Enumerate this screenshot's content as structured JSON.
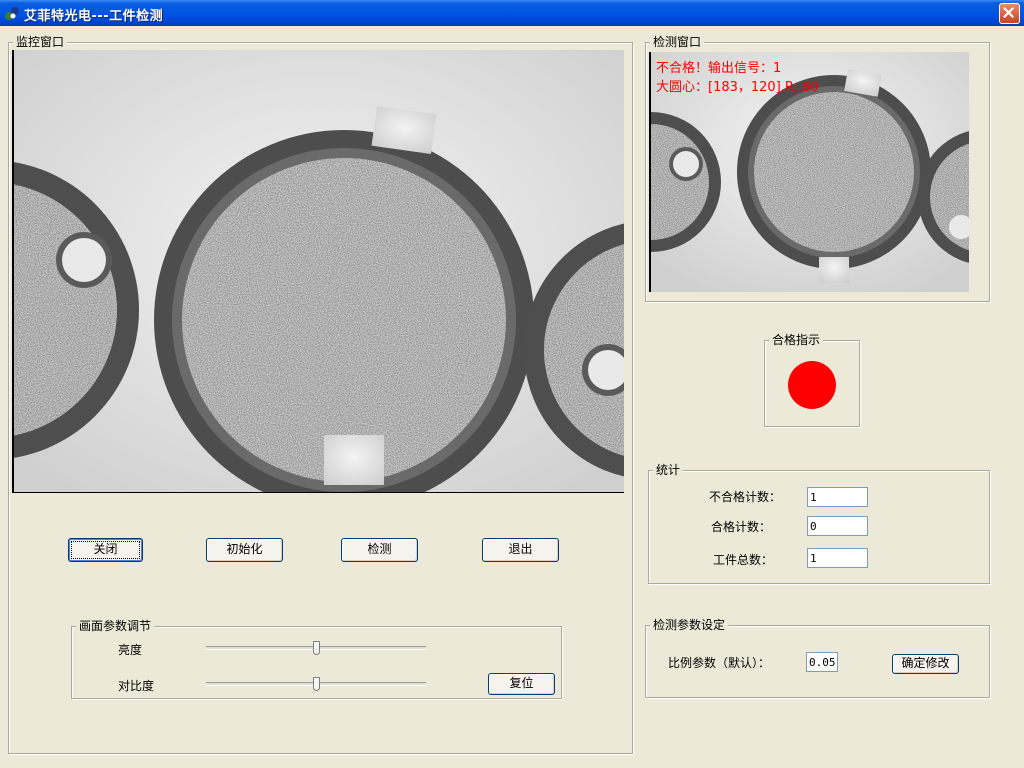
{
  "window": {
    "title": "艾菲特光电---工件检测",
    "icon": "app-logo-icon",
    "close_icon": "close-icon"
  },
  "monitor": {
    "label": "监控窗口"
  },
  "detect": {
    "label": "检测窗口",
    "overlay_line1": "不合格！输出信号：1",
    "overlay_line2": "大圆心：[183，120],R: 80",
    "overlay_color": "#ff0000"
  },
  "buttons": {
    "close": "关闭",
    "init": "初始化",
    "detect": "检测",
    "exit": "退出"
  },
  "image_params": {
    "label": "画面参数调节",
    "brightness_label": "亮度",
    "brightness_level": 0.5,
    "contrast_label": "对比度",
    "contrast_level": 0.5,
    "reset_button": "复位"
  },
  "pass_indicator": {
    "label": "合格指示",
    "status_color": "#ff0000"
  },
  "stats": {
    "label": "统计",
    "fail_count_label": "不合格计数：",
    "fail_count": "1",
    "pass_count_label": "合格计数：",
    "pass_count": "0",
    "total_label": "工件总数：",
    "total": "1"
  },
  "detect_params": {
    "label": "检测参数设定",
    "ratio_label": "比例参数（默认）：",
    "ratio_value": "0.05",
    "confirm_button": "确定修改"
  }
}
